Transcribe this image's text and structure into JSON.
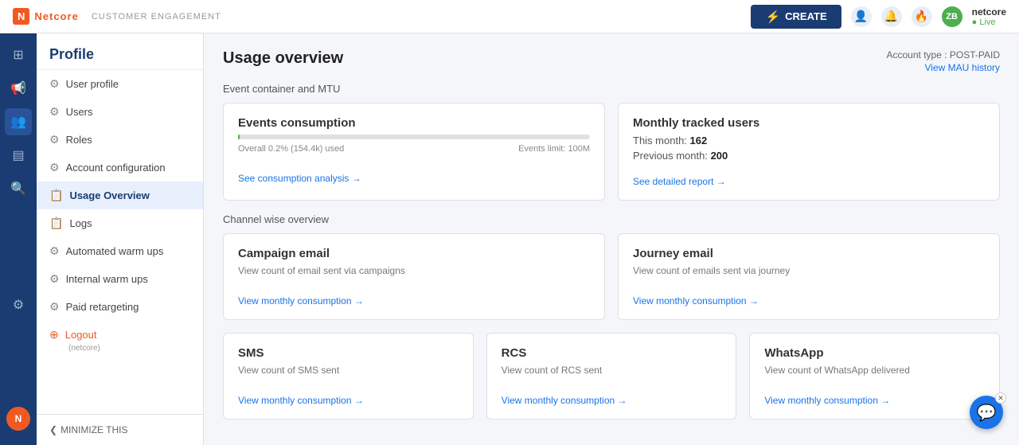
{
  "app": {
    "logo_abbr": "N",
    "logo_name": "Netcore",
    "subtitle": "CUSTOMER ENGAGEMENT",
    "create_label": "CREATE",
    "account_name": "netcore",
    "account_status": "● Live",
    "avatar_initials": "ZB"
  },
  "sidebar": {
    "title": "Profile",
    "items": [
      {
        "id": "user-profile",
        "label": "User profile",
        "icon": "👤"
      },
      {
        "id": "users",
        "label": "Users",
        "icon": "⚙"
      },
      {
        "id": "roles",
        "label": "Roles",
        "icon": "⚙"
      },
      {
        "id": "account-configuration",
        "label": "Account configuration",
        "icon": "⚙"
      },
      {
        "id": "usage-overview",
        "label": "Usage Overview",
        "icon": "📋",
        "active": true
      },
      {
        "id": "logs",
        "label": "Logs",
        "icon": "📋"
      },
      {
        "id": "automated-warm-ups",
        "label": "Automated warm ups",
        "icon": "⚙"
      },
      {
        "id": "internal-warm-ups",
        "label": "Internal warm ups",
        "icon": "⚙"
      },
      {
        "id": "paid-retargeting",
        "label": "Paid retargeting",
        "icon": "⚙"
      }
    ],
    "logout_label": "Logout",
    "logout_sub": "(netcore)",
    "minimize_label": "MINIMIZE THIS"
  },
  "main": {
    "title": "Usage overview",
    "account_type_label": "Account type : POST-PAID",
    "view_mau_label": "View MAU history",
    "section1_label": "Event container and MTU",
    "section2_label": "Channel wise overview",
    "events_card": {
      "title": "Events consumption",
      "progress_pct": 0.2,
      "progress_text_left": "Overall 0.2% (154.4k) used",
      "progress_text_right": "Events limit: 100M",
      "link_label": "See consumption analysis →"
    },
    "mtu_card": {
      "title": "Monthly tracked users",
      "this_month_label": "This month:",
      "this_month_value": "162",
      "prev_month_label": "Previous month:",
      "prev_month_value": "200",
      "link_label": "See detailed report →"
    },
    "channel_cards": [
      {
        "id": "campaign-email",
        "title": "Campaign email",
        "desc": "View count of email sent via campaigns",
        "link_label": "View monthly consumption →"
      },
      {
        "id": "journey-email",
        "title": "Journey email",
        "desc": "View count of emails sent via journey",
        "link_label": "View monthly consumption →"
      },
      {
        "id": "sms",
        "title": "SMS",
        "desc": "View count of SMS sent",
        "link_label": "View monthly consumption →"
      },
      {
        "id": "rcs",
        "title": "RCS",
        "desc": "View count of RCS sent",
        "link_label": "View monthly consumption →"
      },
      {
        "id": "whatsapp",
        "title": "WhatsApp",
        "desc": "View count of WhatsApp delivered",
        "link_label": "View monthly consumption →"
      }
    ]
  },
  "icons": {
    "bolt": "⚡",
    "bell": "🔔",
    "fire": "🔥",
    "user": "👤",
    "grid": "⊞",
    "megaphone": "📢",
    "people": "👥",
    "list": "≡",
    "search": "🔍",
    "gear": "⚙",
    "chat": "💬",
    "chevron_left": "❮"
  }
}
